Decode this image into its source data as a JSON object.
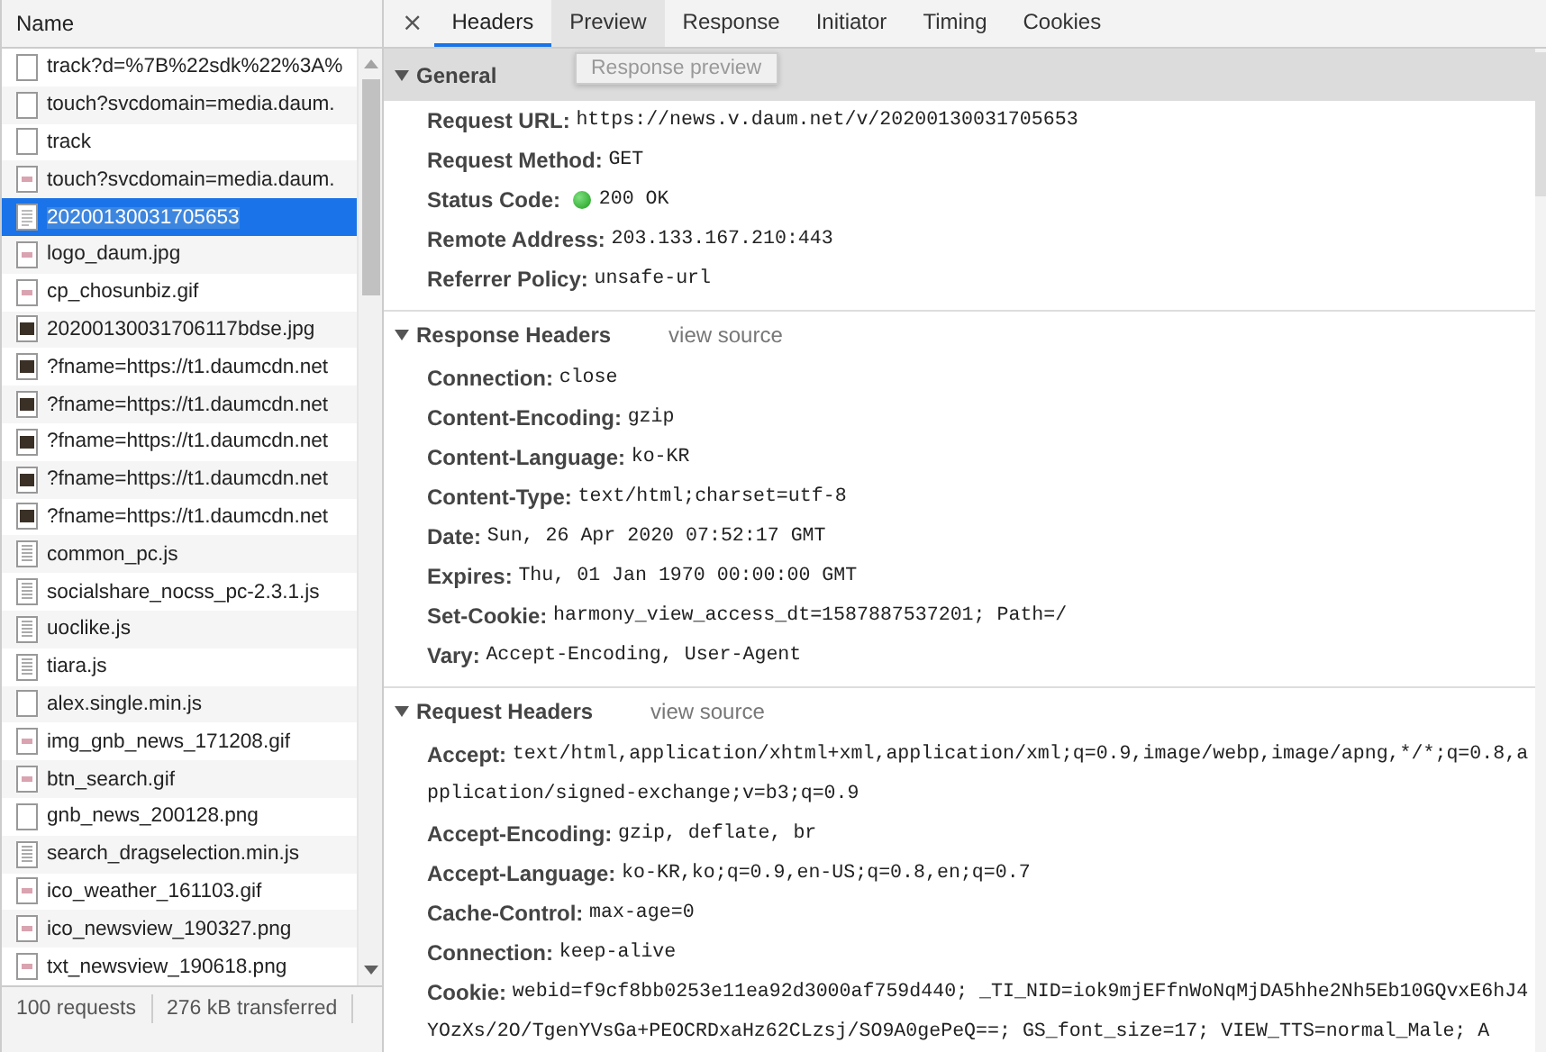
{
  "sidebar": {
    "column_header": "Name",
    "requests": [
      {
        "name": "track?d=%7B%22sdk%22%3A%",
        "kind": "blank",
        "selected": false
      },
      {
        "name": "touch?svcdomain=media.daum.",
        "kind": "blank",
        "selected": false
      },
      {
        "name": "track",
        "kind": "blank",
        "selected": false
      },
      {
        "name": "touch?svcdomain=media.daum.",
        "kind": "image",
        "selected": false
      },
      {
        "name": "20200130031705653",
        "kind": "doc",
        "selected": true
      },
      {
        "name": "logo_daum.jpg",
        "kind": "image",
        "selected": false
      },
      {
        "name": "cp_chosunbiz.gif",
        "kind": "image",
        "selected": false
      },
      {
        "name": "20200130031706117bdse.jpg",
        "kind": "photo",
        "selected": false
      },
      {
        "name": "?fname=https://t1.daumcdn.net",
        "kind": "photo",
        "selected": false
      },
      {
        "name": "?fname=https://t1.daumcdn.net",
        "kind": "photo",
        "selected": false
      },
      {
        "name": "?fname=https://t1.daumcdn.net",
        "kind": "photo",
        "selected": false
      },
      {
        "name": "?fname=https://t1.daumcdn.net",
        "kind": "photo",
        "selected": false
      },
      {
        "name": "?fname=https://t1.daumcdn.net",
        "kind": "photo",
        "selected": false
      },
      {
        "name": "common_pc.js",
        "kind": "script",
        "selected": false
      },
      {
        "name": "socialshare_nocss_pc-2.3.1.js",
        "kind": "script",
        "selected": false
      },
      {
        "name": "uoclike.js",
        "kind": "script",
        "selected": false
      },
      {
        "name": "tiara.js",
        "kind": "script",
        "selected": false
      },
      {
        "name": "alex.single.min.js",
        "kind": "blank",
        "selected": false
      },
      {
        "name": "img_gnb_news_171208.gif",
        "kind": "image",
        "selected": false
      },
      {
        "name": "btn_search.gif",
        "kind": "image",
        "selected": false
      },
      {
        "name": "gnb_news_200128.png",
        "kind": "blank",
        "selected": false
      },
      {
        "name": "search_dragselection.min.js",
        "kind": "script",
        "selected": false
      },
      {
        "name": "ico_weather_161103.gif",
        "kind": "image",
        "selected": false
      },
      {
        "name": "ico_newsview_190327.png",
        "kind": "image",
        "selected": false
      },
      {
        "name": "txt_newsview_190618.png",
        "kind": "image",
        "selected": false
      }
    ]
  },
  "status_bar": {
    "requests": "100 requests",
    "transferred": "276 kB transferred"
  },
  "detail": {
    "close": "×",
    "tabs": [
      {
        "label": "Headers",
        "selected": true,
        "hovered": false
      },
      {
        "label": "Preview",
        "selected": false,
        "hovered": true
      },
      {
        "label": "Response",
        "selected": false,
        "hovered": false
      },
      {
        "label": "Initiator",
        "selected": false,
        "hovered": false
      },
      {
        "label": "Timing",
        "selected": false,
        "hovered": false
      },
      {
        "label": "Cookies",
        "selected": false,
        "hovered": false
      }
    ],
    "tooltip": "Response preview",
    "sections": [
      {
        "title": "General",
        "hovered": true,
        "expanded": true,
        "rows": [
          {
            "key": "Request URL:",
            "value": "https://news.v.daum.net/v/20200130031705653",
            "kind": "plain"
          },
          {
            "key": "Request Method:",
            "value": "GET",
            "kind": "plain"
          },
          {
            "key": "Status Code:",
            "value": "200 OK",
            "kind": "status"
          },
          {
            "key": "Remote Address:",
            "value": "203.133.167.210:443",
            "kind": "plain"
          },
          {
            "key": "Referrer Policy:",
            "value": "unsafe-url",
            "kind": "plain"
          }
        ]
      },
      {
        "title": "Response Headers",
        "link": "view source",
        "hovered": false,
        "expanded": true,
        "rows": [
          {
            "key": "Connection:",
            "value": "close",
            "kind": "plain"
          },
          {
            "key": "Content-Encoding:",
            "value": "gzip",
            "kind": "plain"
          },
          {
            "key": "Content-Language:",
            "value": "ko-KR",
            "kind": "plain"
          },
          {
            "key": "Content-Type:",
            "value": "text/html;charset=utf-8",
            "kind": "plain"
          },
          {
            "key": "Date:",
            "value": "Sun, 26 Apr 2020 07:52:17 GMT",
            "kind": "plain"
          },
          {
            "key": "Expires:",
            "value": "Thu, 01 Jan 1970 00:00:00 GMT",
            "kind": "plain"
          },
          {
            "key": "Set-Cookie:",
            "value": "harmony_view_access_dt=1587887537201; Path=/",
            "kind": "plain"
          },
          {
            "key": "Vary:",
            "value": "Accept-Encoding, User-Agent",
            "kind": "plain"
          }
        ]
      },
      {
        "title": "Request Headers",
        "link": "view source",
        "hovered": false,
        "expanded": true,
        "rows": [
          {
            "key": "Accept:",
            "value": "text/html,application/xhtml+xml,application/xml;q=0.9,image/webp,image/apng,*/*;q=0.8,application/signed-exchange;v=b3;q=0.9",
            "kind": "plain"
          },
          {
            "key": "Accept-Encoding:",
            "value": "gzip, deflate, br",
            "kind": "plain"
          },
          {
            "key": "Accept-Language:",
            "value": "ko-KR,ko;q=0.9,en-US;q=0.8,en;q=0.7",
            "kind": "plain"
          },
          {
            "key": "Cache-Control:",
            "value": "max-age=0",
            "kind": "plain"
          },
          {
            "key": "Connection:",
            "value": "keep-alive",
            "kind": "plain"
          },
          {
            "key": "Cookie:",
            "value": "webid=f9cf8bb0253e11ea92d3000af759d440; _TI_NID=iok9mjEFfnWoNqMjDA5hhe2Nh5Eb10GQvxE6hJ4YOzXs/2O/TgenYVsGa+PEOCRDxaHz62CLzsj/SO9A0gePeQ==; GS_font_size=17; VIEW_TTS=normal_Male; A",
            "kind": "plain"
          }
        ]
      }
    ]
  }
}
